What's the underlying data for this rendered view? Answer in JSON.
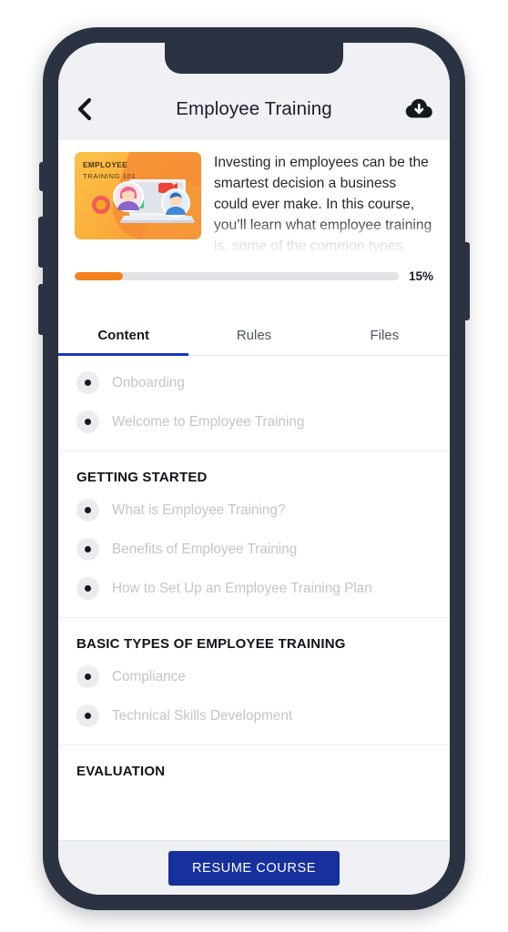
{
  "header": {
    "title": "Employee Training",
    "back_icon": "chevron-left-icon",
    "download_icon": "cloud-download-icon"
  },
  "course": {
    "thumbnail": {
      "title_line1": "EMPLOYEE",
      "title_line2": "TRAINING 101",
      "art": "laptop-video-call-illustration"
    },
    "description": "Investing in employees can be the smartest decision a business could ever make. In this course, you’ll learn what employee training is, some of the common types, and how you",
    "progress": {
      "percent_label": "15%",
      "percent_value": 15,
      "fill_color": "#f58220",
      "track_color": "#e2e3e6"
    }
  },
  "tabs": {
    "active_index": 0,
    "accent_color": "#1a36c4",
    "items": [
      {
        "label": "Content"
      },
      {
        "label": "Rules"
      },
      {
        "label": "Files"
      }
    ]
  },
  "content": {
    "groups": [
      {
        "title": "",
        "items": [
          {
            "label": "Onboarding"
          },
          {
            "label": "Welcome to Employee Training"
          }
        ]
      },
      {
        "title": "GETTING STARTED",
        "items": [
          {
            "label": "What is Employee Training?"
          },
          {
            "label": "Benefits of Employee Training"
          },
          {
            "label": "How to Set Up an Employee Training Plan"
          }
        ]
      },
      {
        "title": "BASIC TYPES OF EMPLOYEE TRAINING",
        "items": [
          {
            "label": "Compliance"
          },
          {
            "label": "Technical Skills Development"
          }
        ]
      },
      {
        "title": "EVALUATION",
        "items": []
      }
    ]
  },
  "bottom_bar": {
    "resume_label": "RESUME COURSE",
    "button_color": "#16309e"
  }
}
